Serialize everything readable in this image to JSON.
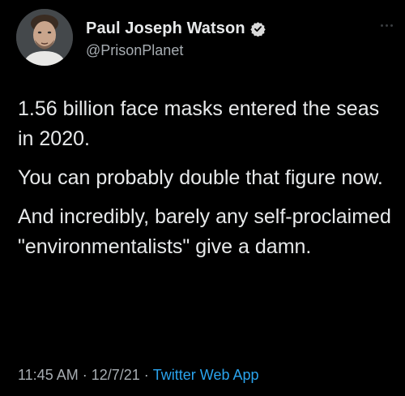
{
  "author": {
    "display_name": "Paul Joseph Watson",
    "handle": "@PrisonPlanet",
    "verified": true
  },
  "tweet": {
    "paragraphs": [
      "1.56 billion face masks entered the seas in 2020.",
      "You can probably double that figure now.",
      "And incredibly, barely any self-proclaimed \"environmentalists\" give a damn."
    ]
  },
  "meta": {
    "time": "11:45 AM",
    "separator": "·",
    "date": "12/7/21",
    "source": "Twitter Web App"
  },
  "colors": {
    "background": "#000000",
    "text": "#e7e9ea",
    "secondary": "#a7adb2",
    "link": "#2aa4ee"
  },
  "icons": [
    "verified-badge-icon",
    "more-options-icon"
  ]
}
